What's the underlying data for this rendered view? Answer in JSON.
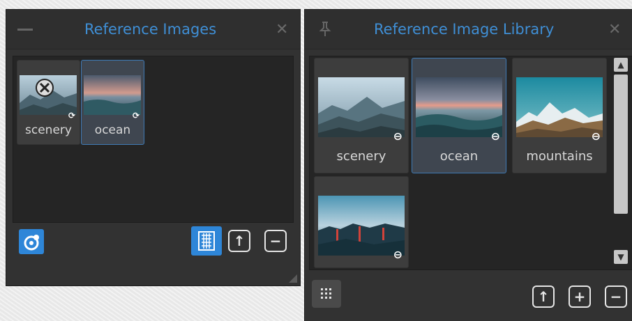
{
  "left_panel": {
    "title": "Reference Images",
    "minimize_icon": "minus-icon",
    "close_icon": "close-icon",
    "close_glyph": "✕",
    "items": [
      {
        "label": "scenery",
        "link_glyph": "⟳"
      },
      {
        "label": "ocean",
        "link_glyph": "⟳"
      }
    ],
    "toolbar": {
      "visibility_icon": "eye-target-icon",
      "grid_icon": "grid-view-icon",
      "import_icon": "import-icon",
      "remove_icon": "remove-icon",
      "import_glyph": "↑",
      "remove_glyph": "−"
    }
  },
  "right_panel": {
    "title": "Reference Image Library",
    "pin_icon": "pin-icon",
    "close_icon": "close-icon",
    "close_glyph": "✕",
    "items": [
      {
        "label": "scenery",
        "link_glyph": "⊖"
      },
      {
        "label": "ocean",
        "link_glyph": "⊖"
      },
      {
        "label": "mountains",
        "link_glyph": "⊖"
      },
      {
        "label": "",
        "link_glyph": "⊖"
      }
    ],
    "toolbar": {
      "grid_icon": "grid-dots-icon",
      "import_icon": "import-icon",
      "add_icon": "add-icon",
      "remove_icon": "remove-icon",
      "import_glyph": "↑",
      "add_glyph": "+",
      "remove_glyph": "−"
    },
    "scroll_up_glyph": "▲",
    "scroll_down_glyph": "▼"
  },
  "colors": {
    "accent": "#3f8fd6",
    "active_button": "#2e86d8",
    "panel": "#323232",
    "content": "#252525"
  }
}
